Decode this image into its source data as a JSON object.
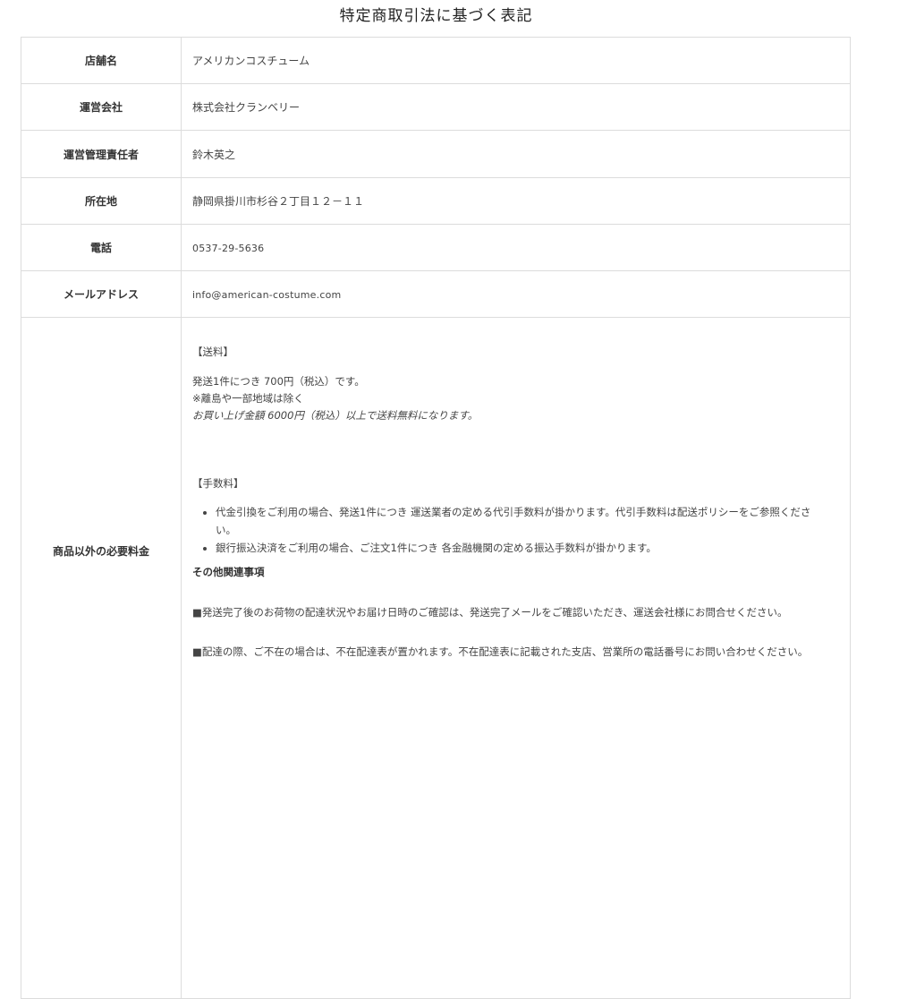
{
  "page": {
    "title": "特定商取引法に基づく表記"
  },
  "rows": [
    {
      "label": "店舗名",
      "value": "アメリカンコスチューム"
    },
    {
      "label": "運営会社",
      "value": "株式会社クランベリー"
    },
    {
      "label": "運営管理責任者",
      "value": "鈴木英之"
    },
    {
      "label": "所在地",
      "value": "静岡県掛川市杉谷２丁目１２－１１"
    },
    {
      "label": "電話",
      "value": "0537-29-5636"
    },
    {
      "label": "メールアドレス",
      "value": "info@american-costume.com"
    }
  ],
  "fees": {
    "label": "商品以外の必要料金",
    "shipping_heading": "【送料】",
    "shipping_line1": "発送1件につき 700円（税込）です。",
    "shipping_line2": "※離島や一部地域は除く",
    "shipping_free": "お買い上げ金額 6000円（税込）以上で送料無料になります。",
    "handling_heading": "【手数料】",
    "handling_items": [
      "代金引換をご利用の場合、発送1件につき 運送業者の定める代引手数料が掛かります。代引手数料は配送ポリシーをご参照ください。",
      "銀行振込決済をご利用の場合、ご注文1件につき 各金融機関の定める振込手数料が掛かります。"
    ],
    "other_heading": "その他関連事項",
    "other_para1": "■発送完了後のお荷物の配達状況やお届け日時のご確認は、発送完了メールをご確認いただき、運送会社様にお問合せください。",
    "other_para2": "■配達の際、ご不在の場合は、不在配達表が置かれます。不在配達表に記載された支店、営業所の電話番号にお問い合わせください。"
  }
}
